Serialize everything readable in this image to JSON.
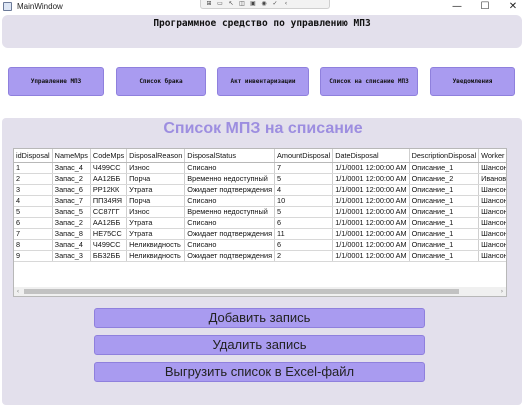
{
  "window": {
    "title": "MainWindow",
    "minimize": "—",
    "maximize": "☐",
    "close": "✕"
  },
  "debug_toolbar": [
    "⊞",
    "▭",
    "↖",
    "◫",
    "▣",
    "◉",
    "✓",
    "‹"
  ],
  "header": {
    "title": "Программное средство по управлению МПЗ"
  },
  "nav": [
    {
      "label": "Управление МПЗ"
    },
    {
      "label": "Список брака"
    },
    {
      "label": "Акт инвентаризации"
    },
    {
      "label": "Список на списание МПЗ"
    },
    {
      "label": "Уведомления"
    }
  ],
  "page_title": "Список МПЗ на списание",
  "grid": {
    "columns": [
      "idDisposal",
      "NameMps",
      "CodeMps",
      "DisposalReason",
      "DisposalStatus",
      "AmountDisposal",
      "DateDisposal",
      "DescriptionDisposal",
      "Worker"
    ],
    "rows": [
      [
        "1",
        "Запас_4",
        "Ч499СС",
        "Износ",
        "Списано",
        "7",
        "1/1/0001 12:00:00 AM",
        "Описание_1",
        "Шансон Ма"
      ],
      [
        "2",
        "Запас_2",
        "АА12ББ",
        "Порча",
        "Временно недоступный",
        "5",
        "1/1/0001 12:00:00 AM",
        "Описание_2",
        "Иванов Ив"
      ],
      [
        "3",
        "Запас_6",
        "РР12КК",
        "Утрата",
        "Ожидает подтверждения",
        "4",
        "1/1/0001 12:00:00 AM",
        "Описание_1",
        "Шансон Ма"
      ],
      [
        "4",
        "Запас_7",
        "ПП34ЯЯ",
        "Порча",
        "Списано",
        "10",
        "1/1/0001 12:00:00 AM",
        "Описание_1",
        "Шансон Ма"
      ],
      [
        "5",
        "Запас_5",
        "СС87ГГ",
        "Износ",
        "Временно недоступный",
        "5",
        "1/1/0001 12:00:00 AM",
        "Описание_1",
        "Шансон Ма"
      ],
      [
        "6",
        "Запас_2",
        "АА12ББ",
        "Утрата",
        "Списано",
        "6",
        "1/1/0001 12:00:00 AM",
        "Описание_1",
        "Шансон Ма"
      ],
      [
        "7",
        "Запас_8",
        "НЕ75СС",
        "Утрата",
        "Ожидает подтверждения",
        "11",
        "1/1/0001 12:00:00 AM",
        "Описание_1",
        "Шансон Ма"
      ],
      [
        "8",
        "Запас_4",
        "Ч499СС",
        "Неликвидность",
        "Списано",
        "6",
        "1/1/0001 12:00:00 AM",
        "Описание_1",
        "Шансон Ма"
      ],
      [
        "9",
        "Запас_3",
        "ББ32ББ",
        "Неликвидность",
        "Ожидает подтверждения",
        "2",
        "1/1/0001 12:00:00 AM",
        "Описание_1",
        "Шансон Ма"
      ]
    ]
  },
  "actions": {
    "add": "Добавить запись",
    "delete": "Удалить запись",
    "export": "Выгрузить список в Excel-файл"
  }
}
